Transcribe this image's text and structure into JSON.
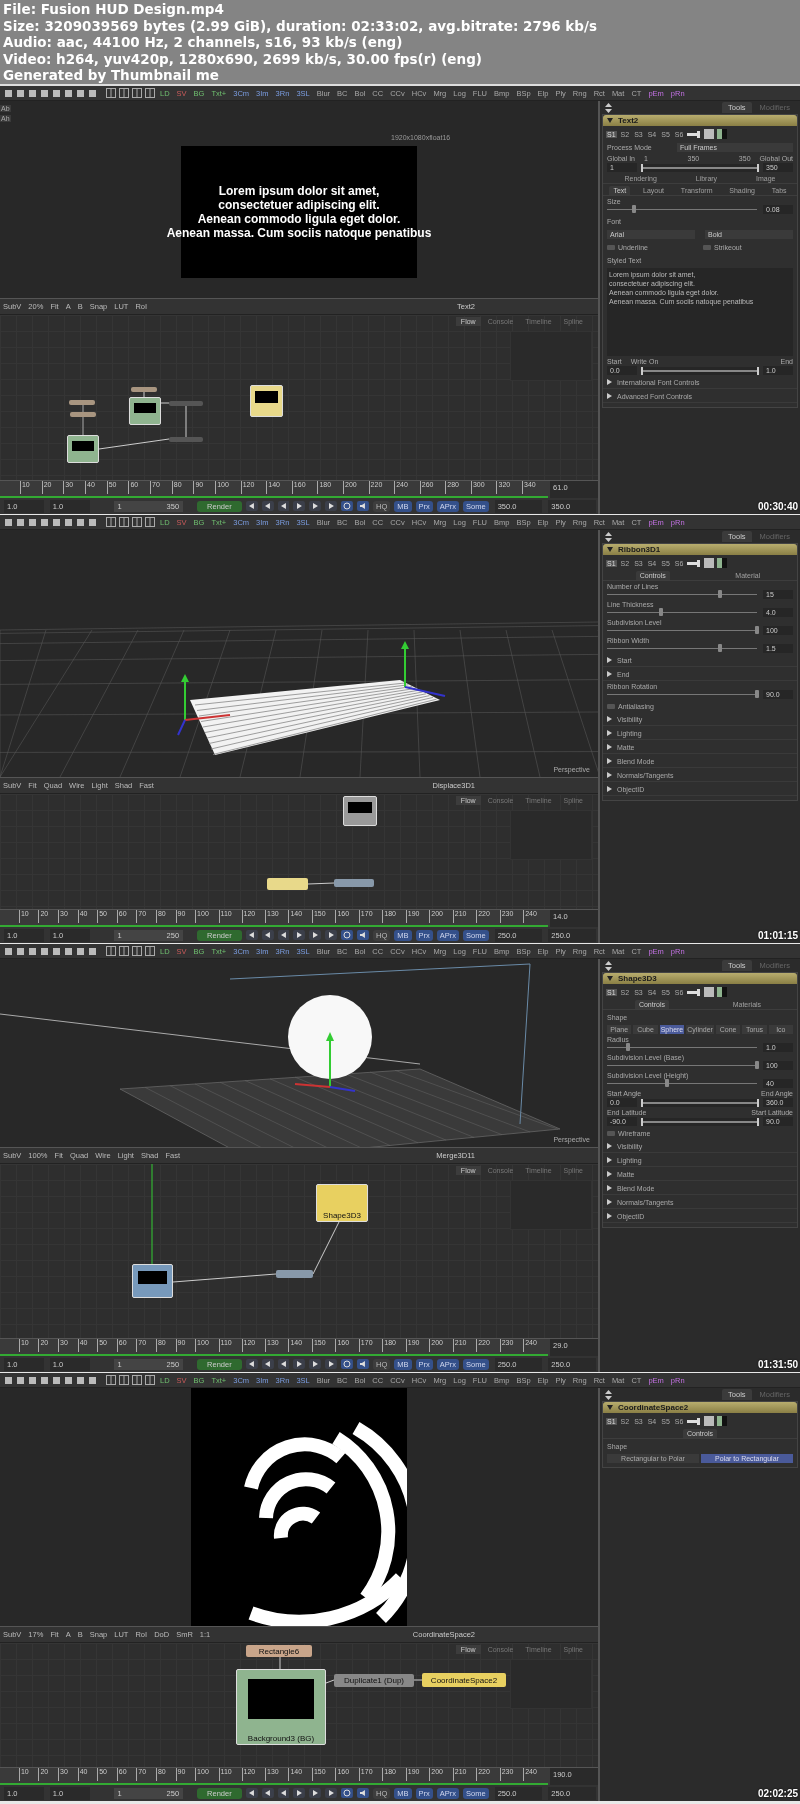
{
  "info": [
    "File: Fusion HUD Design.mp4",
    "Size: 3209039569 bytes (2.99 GiB), duration: 02:33:02, avg.bitrate: 2796 kb/s",
    "Audio: aac, 44100 Hz, 2 channels, s16, 93 kb/s (eng)",
    "Video: h264, yuv420p, 1280x690, 2699 kb/s, 30.00 fps(r) (eng)",
    "Generated by Thumbnail me"
  ],
  "frames": [
    {
      "timestamp": "00:30:40",
      "toolbar": [
        "LD",
        "SV",
        "BG",
        "Txt+",
        "3Cm",
        "3Im",
        "3Rn",
        "3SL",
        "Blur",
        "BC",
        "Bol",
        "CC",
        "CCv",
        "HCv",
        "Mrg",
        "Log",
        "FLU",
        "Bmp",
        "BSp",
        "Elp",
        "Ply",
        "Rng",
        "Rct",
        "Mat",
        "CT",
        "pEm",
        "pRn"
      ],
      "viewer": {
        "kind": "text",
        "side_labels": [
          "Ab",
          "Ah"
        ],
        "resolution": "1920x1080xfloat16",
        "lines": [
          "Lorem ipsum dolor sit amet,",
          "consectetuer adipiscing elit.",
          "Aenean commodo ligula eget dolor.",
          "Aenean massa. Cum sociis natoque penatibus"
        ]
      },
      "viewer_toolbar": {
        "items": [
          "SubV",
          "20%",
          "Fit",
          "A",
          "B",
          "Snap",
          "LUT",
          "RoI"
        ],
        "title": "Text2"
      },
      "flow": {
        "tabs": [
          {
            "label": "Flow",
            "selected": true
          },
          {
            "label": "Console",
            "selected": false
          },
          {
            "label": "Timeline",
            "selected": false
          },
          {
            "label": "Spline",
            "selected": false
          }
        ],
        "nodes": [
          {
            "kind": "bar",
            "color": "#a89580"
          },
          {
            "kind": "bar",
            "color": "#a89580"
          },
          {
            "kind": "bar",
            "color": "#a89580"
          },
          {
            "kind": "tile",
            "color": "#8fb48f"
          },
          {
            "kind": "tile",
            "color": "#8fb48f"
          },
          {
            "kind": "bar",
            "color": "#555555"
          },
          {
            "kind": "bar",
            "color": "#555555"
          },
          {
            "kind": "tile",
            "color": "#e8d98a"
          }
        ]
      },
      "timeline": {
        "ticks": [
          "10",
          "20",
          "30",
          "40",
          "50",
          "60",
          "70",
          "80",
          "90",
          "100",
          "120",
          "140",
          "160",
          "180",
          "200",
          "220",
          "240",
          "260",
          "280",
          "300",
          "320",
          "340"
        ],
        "current": "61.0",
        "start": "1.0",
        "render_start": "1.0",
        "range_start": "1",
        "range_end": "350",
        "render": "Render",
        "toggles": [
          {
            "label": "HQ",
            "on": false
          },
          {
            "label": "MB",
            "on": true
          },
          {
            "label": "Prx",
            "on": true
          },
          {
            "label": "APrx",
            "on": true
          },
          {
            "label": "Some",
            "on": true
          }
        ],
        "render_end": "350.0",
        "end": "350.0"
      },
      "panel": {
        "tabs": [
          {
            "label": "Tools",
            "selected": true
          },
          {
            "label": "Modifiers",
            "selected": false
          }
        ],
        "title": "Text2",
        "slots": [
          {
            "label": "S1",
            "selected": true
          },
          {
            "label": "S2",
            "selected": false
          },
          {
            "label": "S3",
            "selected": false
          },
          {
            "label": "S4",
            "selected": false
          },
          {
            "label": "S5",
            "selected": false
          },
          {
            "label": "S6",
            "selected": false
          }
        ],
        "rows": [
          {
            "kind": "dropdown",
            "label": "Process Mode",
            "value": "Full Frames"
          },
          {
            "kind": "range",
            "start_label": "Global In",
            "marks": [
              "1",
              "350",
              "350"
            ],
            "end_label": "Global Out",
            "start_value": "1",
            "end_value": "350",
            "level": 1
          },
          {
            "kind": "tabs",
            "items": [
              {
                "label": "Rendering",
                "selected": false
              },
              {
                "label": "Library",
                "selected": false
              },
              {
                "label": "Image",
                "selected": false
              }
            ]
          },
          {
            "kind": "tabs",
            "items": [
              {
                "label": "Text",
                "selected": true
              },
              {
                "label": "Layout",
                "selected": false
              },
              {
                "label": "Transform",
                "selected": false
              },
              {
                "label": "Shading",
                "selected": false
              },
              {
                "label": "Tabs",
                "selected": false
              }
            ]
          },
          {
            "kind": "slider",
            "label": "Size",
            "value": "0.08",
            "level": 0.18
          },
          {
            "kind": "label",
            "text": "Font"
          },
          {
            "kind": "dropdowns",
            "items": [
              "Arial",
              "Bold"
            ]
          },
          {
            "kind": "checks",
            "items": [
              {
                "label": "Underline",
                "checked": false
              },
              {
                "label": "Strikeout",
                "checked": false
              }
            ]
          },
          {
            "kind": "label",
            "text": "Styled Text"
          },
          {
            "kind": "textarea",
            "lines": [
              "Lorem ipsum dolor sit amet,",
              "consectetuer adipiscing elit.",
              "Aenean commodo ligula eget dolor.",
              "Aenean massa. Cum sociis natoque penatibus"
            ]
          },
          {
            "kind": "range",
            "start_label": "Start",
            "marks": [
              "Write On"
            ],
            "end_label": "End",
            "start_value": "0.0",
            "end_value": "1.0",
            "level": 1
          },
          {
            "kind": "section",
            "label": "International Font Controls"
          },
          {
            "kind": "section",
            "label": "Advanced Font Controls"
          }
        ]
      }
    },
    {
      "timestamp": "01:01:15",
      "toolbar": [
        "LD",
        "SV",
        "BG",
        "Txt+",
        "3Cm",
        "3Im",
        "3Rn",
        "3SL",
        "Blur",
        "BC",
        "Bol",
        "CC",
        "CCv",
        "HCv",
        "Mrg",
        "Log",
        "FLU",
        "Bmp",
        "BSp",
        "Elp",
        "Ply",
        "Rng",
        "Rct",
        "Mat",
        "CT",
        "pEm",
        "pRn"
      ],
      "viewer": {
        "kind": "ribbon",
        "label": "Perspective"
      },
      "viewer_toolbar": {
        "items": [
          "SubV",
          "Fit",
          "Quad",
          "Wire",
          "Light",
          "Shad",
          "Fast"
        ],
        "title": "Displace3D1"
      },
      "flow": {
        "tabs": [
          {
            "label": "Flow",
            "selected": true
          },
          {
            "label": "Console",
            "selected": false
          },
          {
            "label": "Timeline",
            "selected": false
          },
          {
            "label": "Spline",
            "selected": false
          }
        ],
        "nodes": [
          {
            "kind": "tile",
            "color": "#9a9a9a"
          },
          {
            "kind": "bar",
            "color": "#e8d98a"
          },
          {
            "kind": "bar",
            "color": "#8899aa"
          }
        ]
      },
      "timeline": {
        "ticks": [
          "10",
          "20",
          "30",
          "40",
          "50",
          "60",
          "70",
          "80",
          "90",
          "100",
          "110",
          "120",
          "130",
          "140",
          "150",
          "160",
          "170",
          "180",
          "190",
          "200",
          "210",
          "220",
          "230",
          "240"
        ],
        "current": "14.0",
        "start": "1.0",
        "render_start": "1.0",
        "range_start": "1",
        "range_end": "250",
        "render": "Render",
        "toggles": [
          {
            "label": "HQ",
            "on": false
          },
          {
            "label": "MB",
            "on": true
          },
          {
            "label": "Prx",
            "on": true
          },
          {
            "label": "APrx",
            "on": true
          },
          {
            "label": "Some",
            "on": true
          }
        ],
        "render_end": "250.0",
        "end": "250.0"
      },
      "panel": {
        "tabs": [
          {
            "label": "Tools",
            "selected": true
          },
          {
            "label": "Modifiers",
            "selected": false
          }
        ],
        "title": "Ribbon3D1",
        "slots": [
          {
            "label": "S1",
            "selected": true
          },
          {
            "label": "S2",
            "selected": false
          },
          {
            "label": "S3",
            "selected": false
          },
          {
            "label": "S4",
            "selected": false
          },
          {
            "label": "S5",
            "selected": false
          },
          {
            "label": "S6",
            "selected": false
          }
        ],
        "rows": [
          {
            "kind": "tabs",
            "items": [
              {
                "label": "Controls",
                "selected": true
              },
              {
                "label": "Material",
                "selected": false
              }
            ]
          },
          {
            "kind": "slider",
            "label": "Number of Lines",
            "value": "15",
            "level": 0.75
          },
          {
            "kind": "slider",
            "label": "Line Thickness",
            "value": "4.0",
            "level": 0.36
          },
          {
            "kind": "slider",
            "label": "Subdivision Level",
            "value": "100",
            "level": 1
          },
          {
            "kind": "slider",
            "label": "Ribbon Width",
            "value": "1.5",
            "level": 0.75
          },
          {
            "kind": "section",
            "label": "Start"
          },
          {
            "kind": "section",
            "label": "End"
          },
          {
            "kind": "slider",
            "label": "Ribbon Rotation",
            "value": "90.0",
            "level": 1
          },
          {
            "kind": "checks",
            "items": [
              {
                "label": "Antialiasing",
                "checked": false
              }
            ]
          },
          {
            "kind": "section",
            "label": "Visibility"
          },
          {
            "kind": "section",
            "label": "Lighting"
          },
          {
            "kind": "section",
            "label": "Matte"
          },
          {
            "kind": "section",
            "label": "Blend Mode"
          },
          {
            "kind": "section",
            "label": "Normals/Tangents"
          },
          {
            "kind": "section",
            "label": "ObjectID"
          }
        ]
      }
    },
    {
      "timestamp": "01:31:50",
      "toolbar": [
        "LD",
        "SV",
        "BG",
        "Txt+",
        "3Cm",
        "3Im",
        "3Rn",
        "3SL",
        "Blur",
        "BC",
        "Bol",
        "CC",
        "CCv",
        "HCv",
        "Mrg",
        "Log",
        "FLU",
        "Bmp",
        "BSp",
        "Elp",
        "Ply",
        "Rng",
        "Rct",
        "Mat",
        "CT",
        "pEm",
        "pRn"
      ],
      "viewer": {
        "kind": "sphere",
        "label": "Perspective"
      },
      "viewer_toolbar": {
        "items": [
          "SubV",
          "100%",
          "Fit",
          "Quad",
          "Wire",
          "Light",
          "Shad",
          "Fast"
        ],
        "title": "Merge3D11"
      },
      "flow": {
        "tabs": [
          {
            "label": "Flow",
            "selected": true
          },
          {
            "label": "Console",
            "selected": false
          },
          {
            "label": "Timeline",
            "selected": false
          },
          {
            "label": "Spline",
            "selected": false
          }
        ],
        "nodes": [
          {
            "kind": "tile",
            "color": "#e8d060",
            "label": "Shape3D3"
          },
          {
            "kind": "tile",
            "color": "#7799bb"
          },
          {
            "kind": "bar",
            "color": "#8899aa"
          }
        ]
      },
      "timeline": {
        "ticks": [
          "10",
          "20",
          "30",
          "40",
          "50",
          "60",
          "70",
          "80",
          "90",
          "100",
          "110",
          "120",
          "130",
          "140",
          "150",
          "160",
          "170",
          "180",
          "190",
          "200",
          "210",
          "220",
          "230",
          "240"
        ],
        "current": "29.0",
        "start": "1.0",
        "render_start": "1.0",
        "range_start": "1",
        "range_end": "250",
        "render": "Render",
        "toggles": [
          {
            "label": "HQ",
            "on": false
          },
          {
            "label": "MB",
            "on": true
          },
          {
            "label": "Prx",
            "on": true
          },
          {
            "label": "APrx",
            "on": true
          },
          {
            "label": "Some",
            "on": true
          }
        ],
        "render_end": "250.0",
        "end": "250.0"
      },
      "panel": {
        "tabs": [
          {
            "label": "Tools",
            "selected": true
          },
          {
            "label": "Modifiers",
            "selected": false
          }
        ],
        "title": "Shape3D3",
        "slots": [
          {
            "label": "S1",
            "selected": true
          },
          {
            "label": "S2",
            "selected": false
          },
          {
            "label": "S3",
            "selected": false
          },
          {
            "label": "S4",
            "selected": false
          },
          {
            "label": "S5",
            "selected": false
          },
          {
            "label": "S6",
            "selected": false
          }
        ],
        "rows": [
          {
            "kind": "tabs",
            "items": [
              {
                "label": "Controls",
                "selected": true
              },
              {
                "label": "Materials",
                "selected": false
              }
            ]
          },
          {
            "kind": "label",
            "text": "Shape"
          },
          {
            "kind": "buttons",
            "items": [
              {
                "label": "Plane",
                "selected": false
              },
              {
                "label": "Cube",
                "selected": false
              },
              {
                "label": "Sphere",
                "selected": true
              },
              {
                "label": "Cylinder",
                "selected": false
              },
              {
                "label": "Cone",
                "selected": false
              },
              {
                "label": "Torus",
                "selected": false
              },
              {
                "label": "Ico",
                "selected": false
              }
            ]
          },
          {
            "kind": "slider",
            "label": "Radius",
            "value": "1.0",
            "level": 0.14
          },
          {
            "kind": "slider",
            "label": "Subdivision Level (Base)",
            "value": "100",
            "level": 1
          },
          {
            "kind": "slider",
            "label": "Subdivision Level (Height)",
            "value": "40",
            "level": 0.4
          },
          {
            "kind": "range",
            "start_label": "Start Angle",
            "marks": [],
            "end_label": "End Angle",
            "start_value": "0.0",
            "end_value": "360.0",
            "level": 1
          },
          {
            "kind": "range",
            "start_label": "End Latitude",
            "marks": [],
            "end_label": "Start Latitude",
            "start_value": "-90.0",
            "end_value": "90.0",
            "level": 1
          },
          {
            "kind": "checks",
            "items": [
              {
                "label": "Wireframe",
                "checked": false
              }
            ]
          },
          {
            "kind": "section",
            "label": "Visibility"
          },
          {
            "kind": "section",
            "label": "Lighting"
          },
          {
            "kind": "section",
            "label": "Matte"
          },
          {
            "kind": "section",
            "label": "Blend Mode"
          },
          {
            "kind": "section",
            "label": "Normals/Tangents"
          },
          {
            "kind": "section",
            "label": "ObjectID"
          }
        ]
      }
    },
    {
      "timestamp": "02:02:25",
      "toolbar": [
        "LD",
        "SV",
        "BG",
        "Txt+",
        "3Cm",
        "3Im",
        "3Rn",
        "3SL",
        "Blur",
        "BC",
        "Bol",
        "CC",
        "CCv",
        "HCv",
        "Mrg",
        "Log",
        "FLU",
        "Bmp",
        "BSp",
        "Elp",
        "Ply",
        "Rng",
        "Rct",
        "Mat",
        "CT",
        "pEm",
        "pRn"
      ],
      "viewer": {
        "kind": "arcs"
      },
      "viewer_toolbar": {
        "items": [
          "SubV",
          "17%",
          "Fit",
          "A",
          "B",
          "Snap",
          "LUT",
          "RoI",
          "DoD",
          "SmR",
          "1:1"
        ],
        "title": "CoordinateSpace2"
      },
      "flow": {
        "tabs": [
          {
            "label": "Flow",
            "selected": true
          },
          {
            "label": "Console",
            "selected": false
          },
          {
            "label": "Timeline",
            "selected": false
          },
          {
            "label": "Spline",
            "selected": false
          }
        ],
        "nodes": [
          {
            "kind": "bar",
            "color": "#c9a58a",
            "label": "Rectangle6"
          },
          {
            "kind": "tile",
            "color": "#8fb48f",
            "label": "Background3 (BG)"
          },
          {
            "kind": "bar",
            "color": "#888888",
            "label": "Duplicate1 (Dup)"
          },
          {
            "kind": "bar",
            "color": "#e8d060",
            "label": "CoordinateSpace2"
          }
        ]
      },
      "timeline": {
        "ticks": [
          "10",
          "20",
          "30",
          "40",
          "50",
          "60",
          "70",
          "80",
          "90",
          "100",
          "110",
          "120",
          "130",
          "140",
          "150",
          "160",
          "170",
          "180",
          "190",
          "200",
          "210",
          "220",
          "230",
          "240"
        ],
        "current": "190.0",
        "start": "1.0",
        "render_start": "1.0",
        "range_start": "1",
        "range_end": "250",
        "render": "Render",
        "toggles": [
          {
            "label": "HQ",
            "on": false
          },
          {
            "label": "MB",
            "on": true
          },
          {
            "label": "Prx",
            "on": true
          },
          {
            "label": "APrx",
            "on": true
          },
          {
            "label": "Some",
            "on": true
          }
        ],
        "render_end": "250.0",
        "end": "250.0"
      },
      "panel": {
        "tabs": [
          {
            "label": "Tools",
            "selected": true
          },
          {
            "label": "Modifiers",
            "selected": false
          }
        ],
        "title": "CoordinateSpace2",
        "slots": [
          {
            "label": "S1",
            "selected": true
          },
          {
            "label": "S2",
            "selected": false
          },
          {
            "label": "S3",
            "selected": false
          },
          {
            "label": "S4",
            "selected": false
          },
          {
            "label": "S5",
            "selected": false
          },
          {
            "label": "S6",
            "selected": false
          }
        ],
        "rows": [
          {
            "kind": "tabs",
            "items": [
              {
                "label": "Controls",
                "selected": true
              }
            ]
          },
          {
            "kind": "label",
            "text": "Shape"
          },
          {
            "kind": "buttons",
            "items": [
              {
                "label": "Rectangular to Polar",
                "selected": false
              },
              {
                "label": "Polar to Rectangular",
                "selected": true
              }
            ]
          }
        ]
      }
    }
  ]
}
